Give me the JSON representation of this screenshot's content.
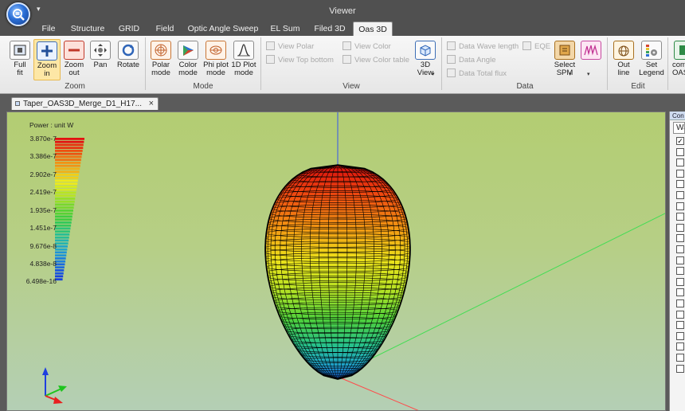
{
  "window": {
    "title": "Viewer"
  },
  "menu": {
    "tabs": [
      {
        "label": "File",
        "active": false
      },
      {
        "label": "Structure",
        "active": false
      },
      {
        "label": "GRID",
        "active": false
      },
      {
        "label": "Field",
        "active": false
      },
      {
        "label": "Optic Angle Sweep",
        "active": false
      },
      {
        "label": "EL Sum",
        "active": false
      },
      {
        "label": "Filed 3D",
        "active": false
      },
      {
        "label": "Oas 3D",
        "active": true
      }
    ]
  },
  "ribbon": {
    "zoom": {
      "label": "Zoom",
      "buttons": [
        {
          "label": "Full\nfit",
          "icon": "full-fit-icon",
          "active": false
        },
        {
          "label": "Zoom\nin",
          "icon": "zoom-in-icon",
          "active": true
        },
        {
          "label": "Zoom\nout",
          "icon": "zoom-out-icon",
          "active": false
        },
        {
          "label": "Pan",
          "icon": "pan-icon",
          "active": false
        },
        {
          "label": "Rotate",
          "icon": "rotate-icon",
          "active": false
        }
      ]
    },
    "mode": {
      "label": "Mode",
      "buttons": [
        {
          "label": "Polar\nmode",
          "icon": "polar-mode-icon"
        },
        {
          "label": "Color\nmode",
          "icon": "color-mode-icon"
        },
        {
          "label": "Phi plot\nmode",
          "icon": "phi-plot-icon"
        },
        {
          "label": "1D Plot\nmode",
          "icon": "plot-1d-icon"
        }
      ]
    },
    "view": {
      "label": "View",
      "small": [
        "View Polar",
        "View Top bottom",
        "View Color",
        "View Color table"
      ],
      "big": {
        "label": "3D\nView",
        "icon": "cube-3d-icon"
      }
    },
    "data": {
      "label": "Data",
      "small": [
        "Data Wave length",
        "Data Angle",
        "Data Total flux",
        "EQE"
      ],
      "big": {
        "label": "Select\nSPM",
        "icon": "select-spm-icon"
      },
      "extra_icon": "spectrum-icon"
    },
    "edit": {
      "label": "Edit",
      "buttons": [
        {
          "label": "Out\nline",
          "icon": "outline-icon"
        },
        {
          "label": "Set\nLegend",
          "icon": "set-legend-icon"
        }
      ]
    },
    "overflow": {
      "label": "com\nOAS",
      "icon": "com-oas-icon"
    }
  },
  "document": {
    "tab_title": "Taper_OAS3D_Merge_D1_H17...",
    "close_glyph": "×"
  },
  "legend": {
    "title": "Power : unit W",
    "ticks": [
      "3.870e-7",
      "3.386e-7",
      "2.902e-7",
      "2.419e-7",
      "1.935e-7",
      "1.451e-7",
      "9.676e-8",
      "4.838e-8",
      "6.498e-16"
    ]
  },
  "side_panel": {
    "header": "Con",
    "combo_value": "Wa",
    "checked_first": true
  }
}
